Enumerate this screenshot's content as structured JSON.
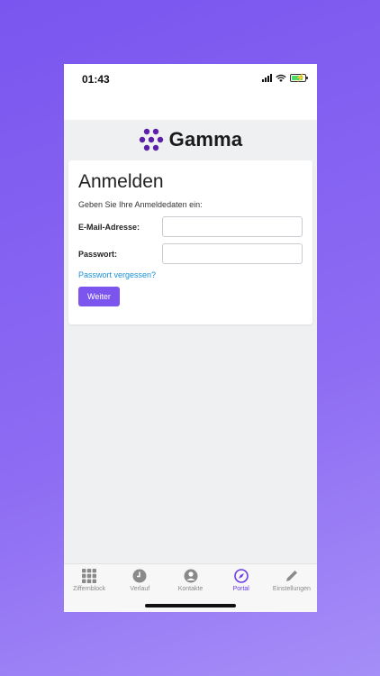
{
  "status": {
    "time": "01:43"
  },
  "brand": {
    "name": "Gamma",
    "color": "#5b1fa8"
  },
  "login": {
    "title": "Anmelden",
    "subtitle": "Geben Sie Ihre Anmeldedaten ein:",
    "email_label": "E-Mail-Adresse:",
    "email_value": "",
    "password_label": "Passwort:",
    "password_value": "",
    "forgot_link": "Passwort vergessen?",
    "submit_label": "Weiter"
  },
  "tabbar": {
    "items": [
      {
        "label": "Ziffernblock",
        "icon": "keypad-icon",
        "active": false
      },
      {
        "label": "Verlauf",
        "icon": "clock-icon",
        "active": false
      },
      {
        "label": "Kontakte",
        "icon": "person-icon",
        "active": false
      },
      {
        "label": "Portal",
        "icon": "compass-icon",
        "active": true
      },
      {
        "label": "Einstellungen",
        "icon": "pencil-icon",
        "active": false
      }
    ]
  },
  "colors": {
    "accent": "#7b55ee",
    "background": "#8e6cf3",
    "link": "#1a8fd6"
  }
}
